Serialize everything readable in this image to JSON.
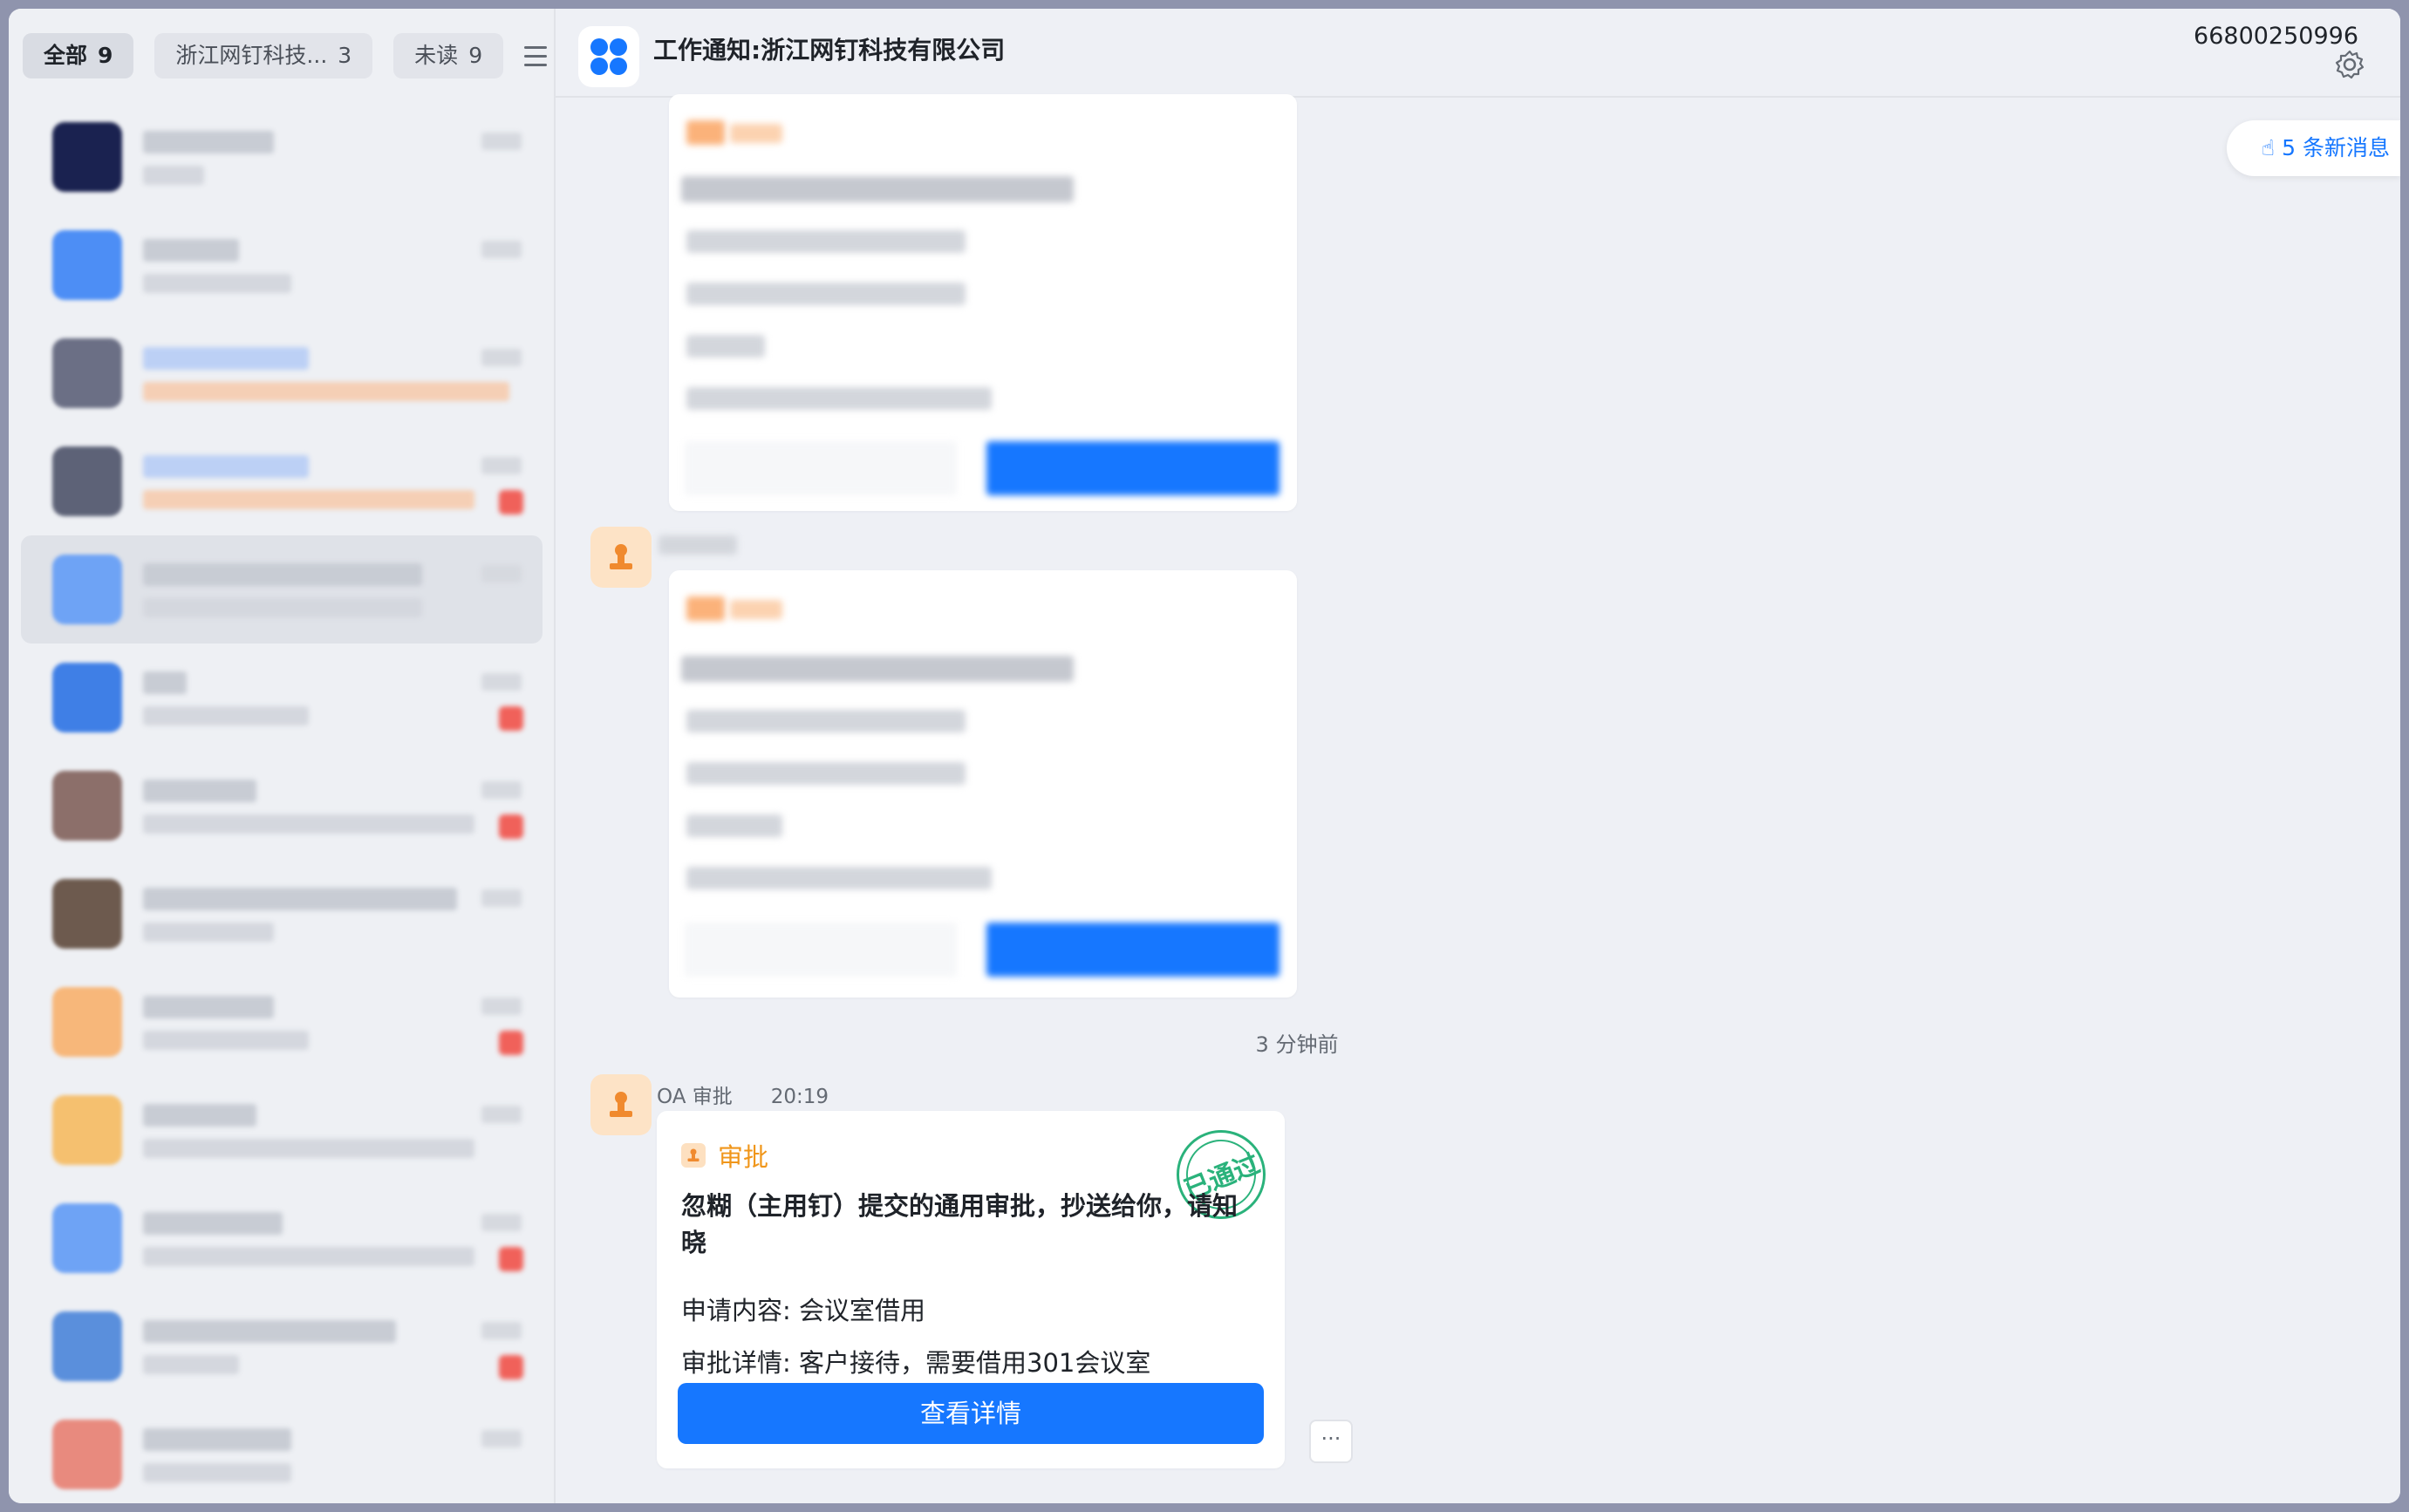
{
  "sidebar": {
    "tabs": [
      {
        "label": "全部",
        "count": "9"
      },
      {
        "label": "浙江网钉科技...",
        "count": "3"
      },
      {
        "label": "未读",
        "count": "9"
      }
    ]
  },
  "chat": {
    "title": "工作通知:浙江网钉科技有限公司",
    "account_id": "66800250996",
    "new_messages": "5 条新消息",
    "time_divider": "3 分钟前",
    "last_message": {
      "sender": "OA 审批",
      "time": "20:19",
      "card_title": "审批",
      "headline": "忽糊（主用钉）提交的通用审批，抄送给你，请知晓",
      "fields": [
        {
          "label": "申请内容:",
          "value": "会议室借用"
        },
        {
          "label": "审批详情:",
          "value": "客户接待，需要借用301会议室"
        }
      ],
      "button": "查看详情",
      "stamp": "已通过"
    },
    "more_label": "···"
  },
  "colors": {
    "primary": "#1677ff",
    "approval_orange": "#f0961a",
    "stamp_green": "#2ab27b",
    "badge_red": "#f0615a"
  }
}
